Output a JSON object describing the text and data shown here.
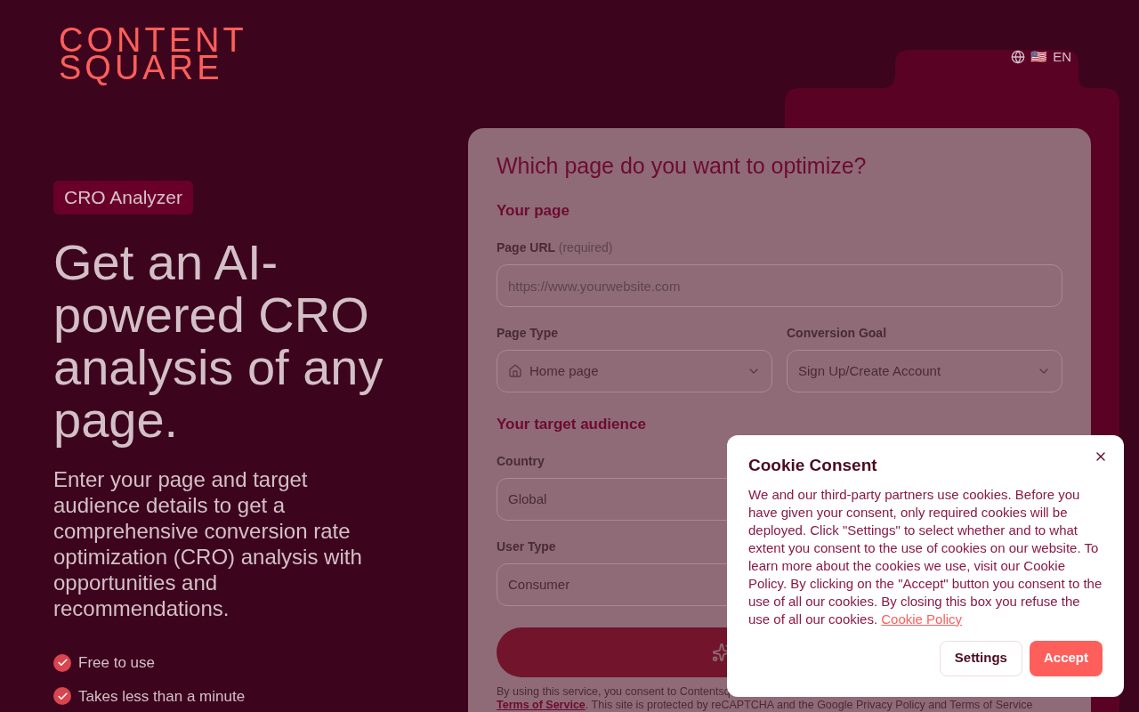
{
  "logo": {
    "line_1": "CONTENT",
    "line_2": "SQUARE"
  },
  "language": {
    "flag": "🇺🇸",
    "code": "EN"
  },
  "badge": "CRO Analyzer",
  "headline": "Get an AI-powered CRO analysis of any page.",
  "intro": "Enter your page and target audience details to get a comprehensive conversion rate optimization (CRO) analysis with opportunities and recommendations.",
  "benefits": [
    "Free to use",
    "Takes less than a minute"
  ],
  "form": {
    "title": "Which page do you want to optimize?",
    "section_1": "Your page",
    "url_label": "Page URL",
    "url_hint": "(required)",
    "url_placeholder": "https://www.yourwebsite.com",
    "page_type": {
      "label": "Page Type",
      "value": "Home page"
    },
    "goal": {
      "label": "Conversion Goal",
      "value": "Sign Up/Create Account"
    },
    "section_2": "Your target audience",
    "country": {
      "label": "Country",
      "value": "Global"
    },
    "user_type": {
      "label": "User Type",
      "value": "Consumer"
    },
    "legal_1": "By using this service, you consent to Contentsq",
    "legal_link": "Terms of Service",
    "legal_2": ". This site is protected by reCAPTCHA and the Google Privacy Policy and Terms of Service"
  },
  "cookie": {
    "title": "Cookie Consent",
    "text": "We and our third-party partners use cookies. Before you have given your consent, only required cookies will be deployed. Click \"Settings\" to select whether and to what extent you consent to the use of cookies on our website. To learn more about the cookies we use, visit our Cookie Policy. By clicking on the \"Accept\" button you consent to the use of all our cookies. By closing this box you refuse the use of all our cookies.",
    "link": "Cookie Policy",
    "settings": "Settings",
    "accept": "Accept"
  }
}
